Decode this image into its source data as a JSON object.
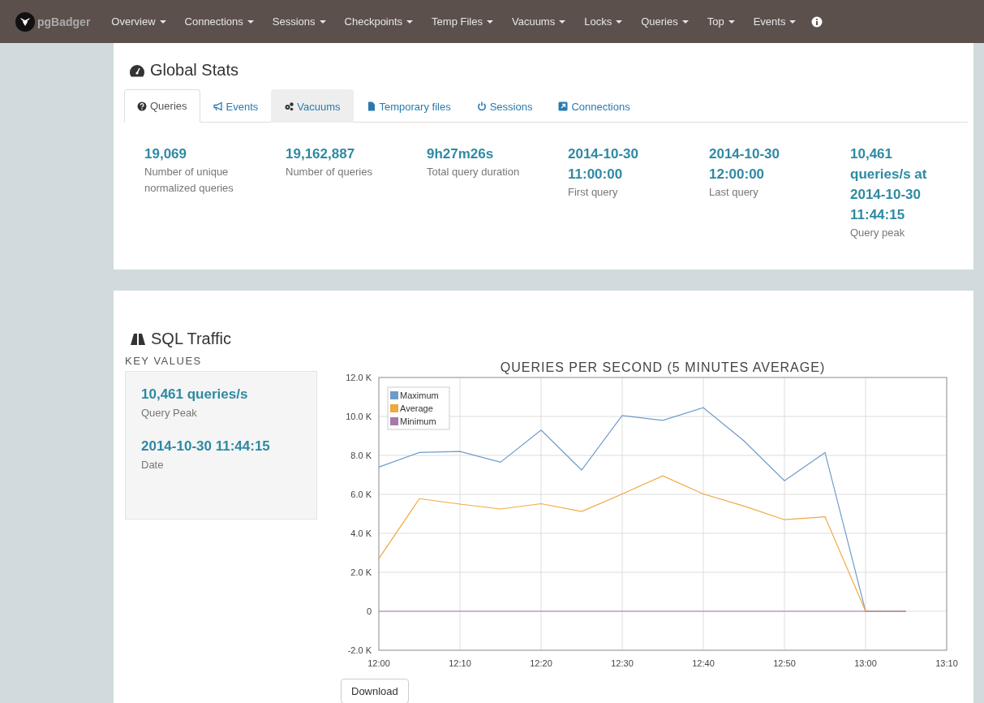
{
  "navbar": {
    "brand": "pgBadger",
    "menus": [
      {
        "label": "Overview"
      },
      {
        "label": "Connections"
      },
      {
        "label": "Sessions"
      },
      {
        "label": "Checkpoints"
      },
      {
        "label": "Temp Files"
      },
      {
        "label": "Vacuums"
      },
      {
        "label": "Locks"
      },
      {
        "label": "Queries"
      },
      {
        "label": "Top"
      },
      {
        "label": "Events"
      }
    ]
  },
  "global_stats": {
    "title": "Global Stats",
    "tabs": [
      {
        "label": "Queries",
        "selected": true
      },
      {
        "label": "Events",
        "selected": false,
        "hovered": false
      },
      {
        "label": "Vacuums",
        "selected": false,
        "hovered": true
      },
      {
        "label": "Temporary files",
        "selected": false,
        "hovered": false
      },
      {
        "label": "Sessions",
        "selected": false,
        "hovered": false
      },
      {
        "label": "Connections",
        "selected": false,
        "hovered": false
      }
    ],
    "stats": [
      {
        "value": "19,069",
        "label": "Number of unique normalized queries"
      },
      {
        "value": "19,162,887",
        "label": "Number of queries"
      },
      {
        "value": "9h27m26s",
        "label": "Total query duration"
      },
      {
        "value": "2014-10-30 11:00:00",
        "label": "First query"
      },
      {
        "value": "2014-10-30 12:00:00",
        "label": "Last query"
      },
      {
        "value": "10,461 queries/s at 2014-10-30 11:44:15",
        "label": "Query peak"
      }
    ]
  },
  "sql_traffic": {
    "title": "SQL Traffic",
    "key_values_heading": "KEY VALUES",
    "key_values": [
      {
        "value": "10,461 queries/s",
        "label": "Query Peak"
      },
      {
        "value": "2014-10-30 11:44:15",
        "label": "Date"
      }
    ],
    "chart_data": {
      "type": "line",
      "title": "QUERIES PER SECOND (5 MINUTES AVERAGE)",
      "categories": [
        "12:00",
        null,
        "12:10",
        null,
        "12:20",
        null,
        "12:30",
        null,
        "12:40",
        null,
        "12:50",
        null,
        "13:00",
        null,
        "13:10"
      ],
      "series": [
        {
          "name": "Maximum",
          "color": "#6f9bc9",
          "values": [
            7400,
            8150,
            8200,
            7650,
            9300,
            7250,
            10050,
            9800,
            10450,
            8750,
            6700,
            8150,
            0,
            0,
            null
          ]
        },
        {
          "name": "Average",
          "color": "#f0a840",
          "values": [
            2700,
            5780,
            5500,
            5250,
            5520,
            5120,
            6020,
            6950,
            6020,
            5400,
            4700,
            4850,
            0,
            0,
            null
          ]
        },
        {
          "name": "Minimum",
          "color": "#a77aa8",
          "values": [
            0,
            0,
            0,
            0,
            0,
            0,
            0,
            0,
            0,
            0,
            0,
            0,
            0,
            0,
            null
          ]
        }
      ],
      "ylim": [
        -2000,
        12000
      ],
      "grid": true,
      "legend": true,
      "yticks": [
        {
          "value": -2000,
          "label": "-2.0 K"
        },
        {
          "value": 0,
          "label": "0"
        },
        {
          "value": 2000,
          "label": "2.0 K"
        },
        {
          "value": 4000,
          "label": "4.0 K"
        },
        {
          "value": 6000,
          "label": "6.0 K"
        },
        {
          "value": 8000,
          "label": "8.0 K"
        },
        {
          "value": 10000,
          "label": "10.0 K"
        },
        {
          "value": 12000,
          "label": "12.0 K"
        }
      ]
    },
    "download_button": "Download"
  }
}
